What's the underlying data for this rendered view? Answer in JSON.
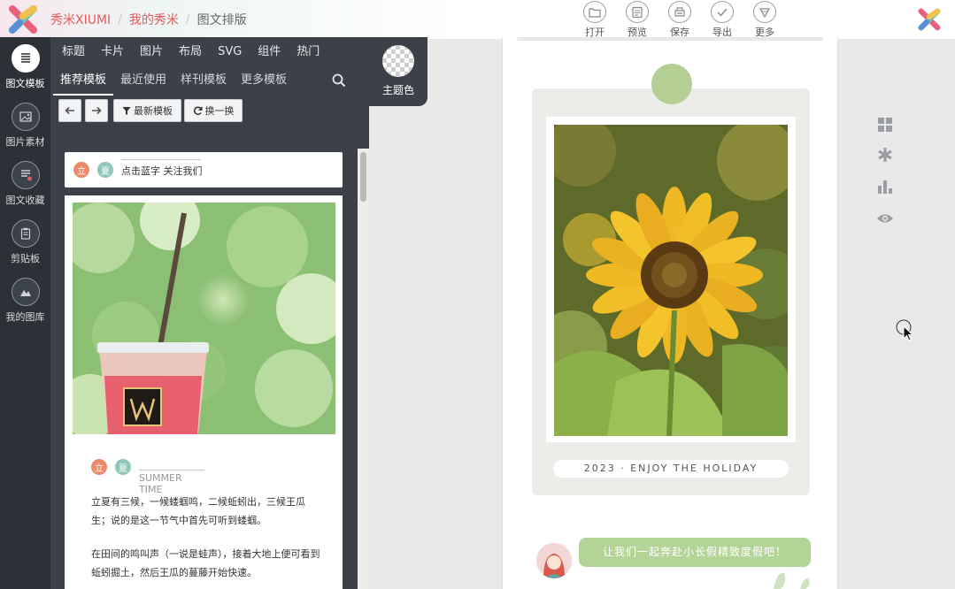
{
  "header": {
    "breadcrumb": [
      "秀米XIUMI",
      "我的秀米",
      "图文排版"
    ],
    "separator": "/",
    "toolbar": [
      {
        "label": "打开",
        "icon": "folder-icon"
      },
      {
        "label": "预览",
        "icon": "preview-icon"
      },
      {
        "label": "保存",
        "icon": "save-icon"
      },
      {
        "label": "导出",
        "icon": "export-icon"
      },
      {
        "label": "更多",
        "icon": "more-icon"
      }
    ]
  },
  "rail": [
    {
      "label": "图文模板",
      "icon": "template-icon",
      "active": true
    },
    {
      "label": "图片素材",
      "icon": "image-icon",
      "active": false
    },
    {
      "label": "图文收藏",
      "icon": "favorites-icon",
      "active": false
    },
    {
      "label": "剪贴板",
      "icon": "clipboard-icon",
      "active": false
    },
    {
      "label": "我的图库",
      "icon": "gallery-icon",
      "active": false
    }
  ],
  "panel": {
    "categories": [
      "标题",
      "卡片",
      "图片",
      "布局",
      "SVG",
      "组件",
      "热门"
    ],
    "subtabs": [
      "推荐模板",
      "最近使用",
      "样刊模板",
      "更多模板"
    ],
    "active_subtab": "推荐模板",
    "theme_label": "主题色",
    "buttons": {
      "newest": "最新模板",
      "shuffle": "换一换"
    },
    "card1": {
      "tag1": "立",
      "tag2": "夏",
      "text": "点击蓝字 关注我们"
    },
    "card2": {
      "tag1": "立",
      "tag2": "夏",
      "subtitle": "SUMMER TIME",
      "para1": "立夏有三候，一候蝼蝈鸣，二候蚯蚓出，三候王瓜生；说的是这一节气中首先可听到蝼蝈。",
      "para2": "在田间的鸣叫声（一说是蛙声），接着大地上便可看到蚯蚓掘土，然后王瓜的蔓藤开始快速。"
    }
  },
  "canvas": {
    "caption": "2023 · ENJOY THE HOLIDAY",
    "bubble": "让我们一起奔赴小长假精致度假吧！"
  },
  "side_tools": [
    "grid-icon",
    "asterisk-icon",
    "bar-chart-icon",
    "eye-icon"
  ],
  "colors": {
    "accent_red": "#e35a5a",
    "rail_bg": "#2c3138",
    "panel_bg": "#3c4149",
    "green": "#b4cf94",
    "tag_orange": "#ee8a6c",
    "tag_teal": "#8fc7b8"
  }
}
